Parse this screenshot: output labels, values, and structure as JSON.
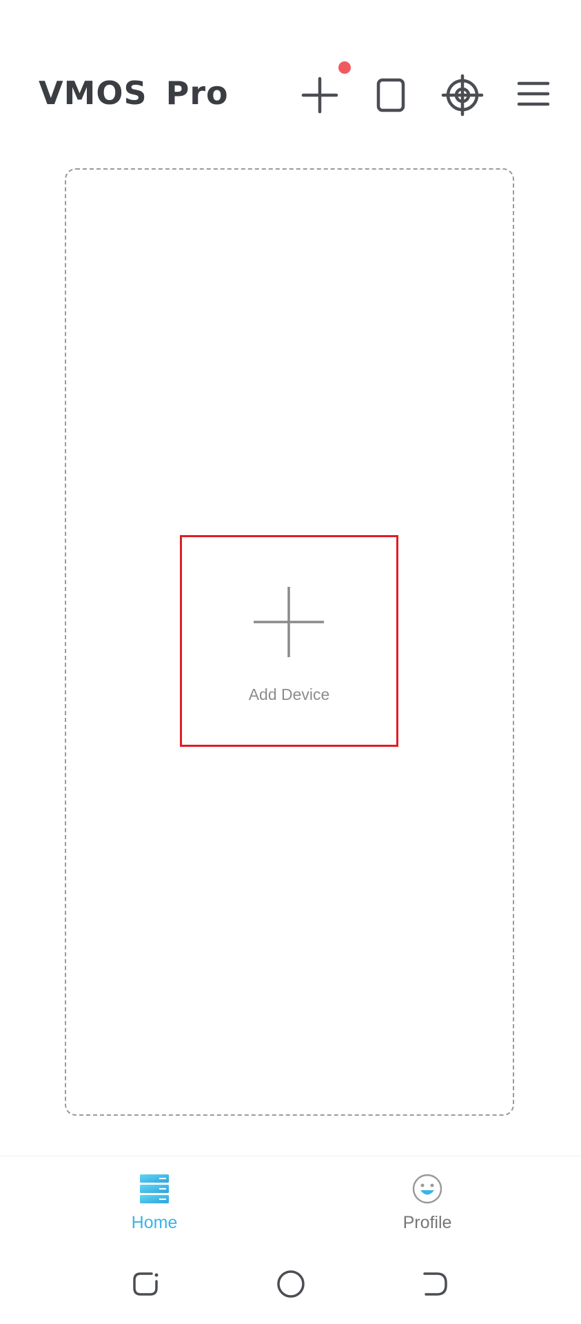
{
  "header": {
    "app_title": "VMOS Pro",
    "toolbar": [
      {
        "name": "add-icon",
        "has_notification": true
      },
      {
        "name": "phone-frame-icon"
      },
      {
        "name": "crosshair-target-icon"
      },
      {
        "name": "hamburger-menu-icon"
      }
    ]
  },
  "main": {
    "add_device": {
      "label": "Add Device",
      "icon": "plus-icon",
      "highlighted": true
    }
  },
  "bottom_nav": {
    "tabs": [
      {
        "label": "Home",
        "icon": "server-stack-icon",
        "active": true
      },
      {
        "label": "Profile",
        "icon": "smiley-face-icon",
        "active": false
      }
    ]
  },
  "system_nav": {
    "buttons": [
      "recent-apps-icon",
      "home-circle-icon",
      "back-icon"
    ]
  },
  "colors": {
    "title": "#3a3d42",
    "icon": "#4a4d52",
    "notification_dot": "#f05a5f",
    "highlight_border": "#e01c24",
    "plus_gray": "#8a8a8a",
    "active_tab": "#3bb4e6",
    "inactive_tab": "#777777",
    "dashed_border": "#9a9a9a"
  }
}
